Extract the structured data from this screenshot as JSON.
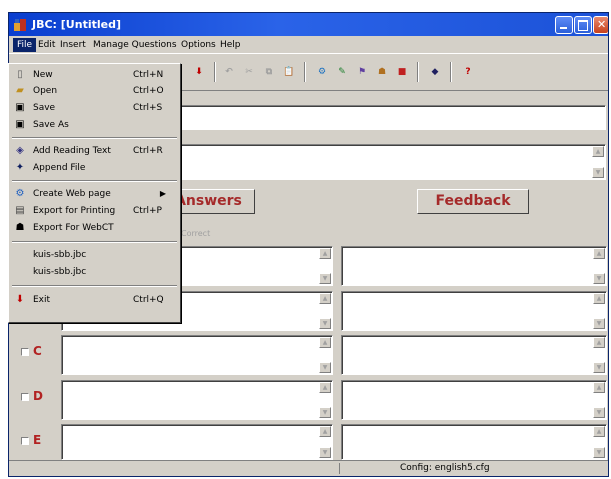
{
  "window": {
    "title": "JBC: [Untitled]"
  },
  "menubar": [
    "File",
    "Edit",
    "Insert",
    "Manage Questions",
    "Options",
    "Help"
  ],
  "file_menu": [
    {
      "label": "New",
      "shortcut": "Ctrl+N",
      "icon": "new-file-icon"
    },
    {
      "label": "Open",
      "shortcut": "Ctrl+O",
      "icon": "open-folder-icon"
    },
    {
      "label": "Save",
      "shortcut": "Ctrl+S",
      "icon": "save-disk-icon"
    },
    {
      "label": "Save As",
      "shortcut": "",
      "icon": "save-as-icon"
    },
    {
      "label": "Add Reading Text",
      "shortcut": "Ctrl+R",
      "icon": "reading-text-icon"
    },
    {
      "label": "Append File",
      "shortcut": "",
      "icon": "append-file-icon"
    },
    {
      "label": "Create Web page",
      "shortcut": "",
      "icon": "web-page-icon",
      "submenu": true
    },
    {
      "label": "Export for Printing",
      "shortcut": "Ctrl+P",
      "icon": "printer-icon"
    },
    {
      "label": "Export For WebCT",
      "shortcut": "",
      "icon": "webct-icon"
    },
    {
      "label": "kuis-sbb.jbc",
      "shortcut": ""
    },
    {
      "label": "kuis-sbb.jbc",
      "shortcut": ""
    },
    {
      "label": "Exit",
      "shortcut": "Ctrl+Q",
      "icon": "exit-icon"
    }
  ],
  "headers": {
    "answers": "Answers",
    "feedback": "Feedback",
    "correct_hint": "Correct"
  },
  "answers": [
    {
      "letter": "C"
    },
    {
      "letter": "D"
    },
    {
      "letter": "E"
    }
  ],
  "status": {
    "config": "Config: english5.cfg"
  },
  "colors": {
    "titlebar": "#0a3ecf",
    "menu_highlight": "#0a246a",
    "accent_text": "#a52a2a"
  }
}
